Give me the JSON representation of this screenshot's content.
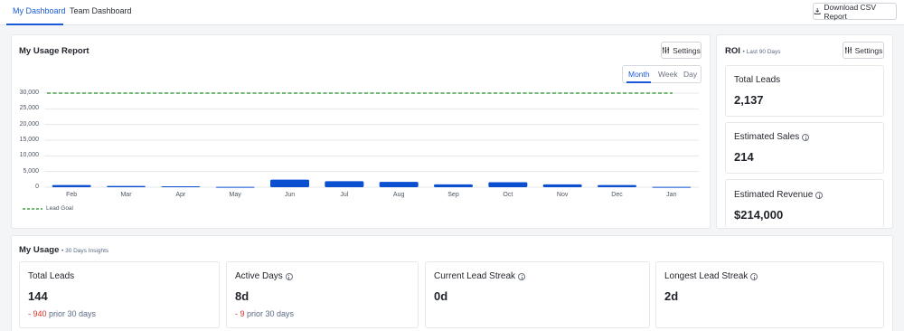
{
  "tabs": {
    "my_dashboard": "My Dashboard",
    "team_dashboard": "Team Dashboard"
  },
  "download_button": "Download CSV Report",
  "usage_report": {
    "title": "My Usage Report",
    "settings_label": "Settings",
    "periods": [
      "Month",
      "Week",
      "Day"
    ],
    "selected_period": "Month",
    "legend_label": "Lead Goal"
  },
  "roi": {
    "title": "ROI",
    "subtitle": "• Last 90 Days",
    "settings_label": "Settings",
    "cards": [
      {
        "label": "Total Leads",
        "value": "2,137",
        "info": false
      },
      {
        "label": "Estimated Sales",
        "value": "214",
        "info": true
      },
      {
        "label": "Estimated Revenue",
        "value": "$214,000",
        "info": true
      }
    ]
  },
  "my_usage": {
    "title": "My Usage",
    "subtitle": "• 30 Days Insights",
    "cards": [
      {
        "label": "Total Leads",
        "value": "144",
        "delta": "- 940",
        "prior": "prior 30 days",
        "info": false
      },
      {
        "label": "Active Days",
        "value": "8d",
        "delta": "- 9",
        "prior": "prior 30 days",
        "info": true
      },
      {
        "label": "Current Lead Streak",
        "value": "0d",
        "info": true
      },
      {
        "label": "Longest Lead Streak",
        "value": "2d",
        "info": true
      }
    ]
  },
  "chart_data": {
    "type": "bar",
    "categories": [
      "Feb",
      "Mar",
      "Apr",
      "May",
      "Jun",
      "Jul",
      "Aug",
      "Sep",
      "Oct",
      "Nov",
      "Dec",
      "Jan"
    ],
    "series": [
      {
        "values": [
          700,
          400,
          300,
          100,
          2400,
          1900,
          1700,
          900,
          1600,
          900,
          700,
          100
        ]
      }
    ],
    "goal": {
      "name": "Lead Goal",
      "value": 30000,
      "color": "#1e8c1e"
    },
    "yticks": [
      "0",
      "5,000",
      "10,000",
      "15,000",
      "20,000",
      "25,000",
      "30,000"
    ],
    "ylim": [
      0,
      30000
    ],
    "bar_color": "#0b4fd1",
    "grid": true,
    "legend": "bottom-left"
  }
}
